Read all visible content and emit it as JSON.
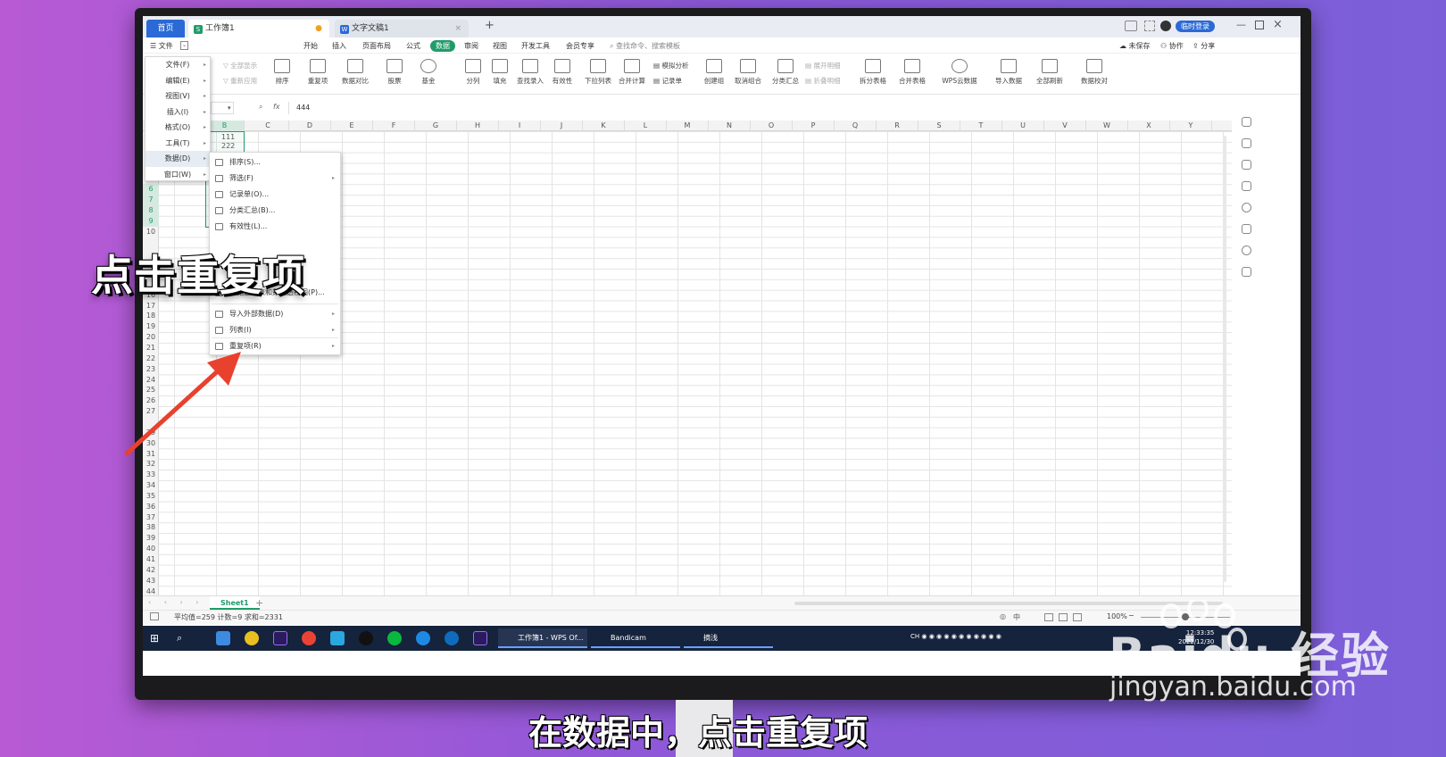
{
  "app": {
    "tab_home": "首页",
    "tab_workbook": "工作簿1",
    "tab_doc": "文字文稿1",
    "login_label": "临时登录"
  },
  "menubar": {
    "file": "文件",
    "tabs": [
      "开始",
      "插入",
      "页面布局",
      "公式",
      "数据",
      "审阅",
      "视图",
      "开发工具",
      "会员专享"
    ],
    "search_placeholder": "查找命令、搜索模板",
    "unsaved": "未保存",
    "collab": "协作",
    "share": "分享"
  },
  "ribbon": {
    "show_all": "全部显示",
    "reapply": "重新应用",
    "buttons": [
      "排序",
      "重复项",
      "数据对比",
      "股票",
      "基金",
      "分列",
      "填充",
      "查找录入",
      "有效性",
      "下拉列表",
      "合并计算",
      "创建组",
      "取消组合",
      "分类汇总",
      "拆分表格",
      "合并表格",
      "WPS云数据",
      "导入数据",
      "全部刷新",
      "数据校对"
    ],
    "simulate": "模拟分析",
    "record": "记录单",
    "expand": "展开明细",
    "collapse": "折叠明细"
  },
  "formula_bar": {
    "fx": "fx",
    "value": "444"
  },
  "columns": [
    "B",
    "C",
    "D",
    "E",
    "F",
    "G",
    "H",
    "I",
    "J",
    "K",
    "L",
    "M",
    "N",
    "O",
    "P",
    "Q",
    "R",
    "S",
    "T",
    "U",
    "V",
    "W",
    "X",
    "Y"
  ],
  "visible_rows": [
    "6",
    "7",
    "8",
    "9",
    "10",
    "16",
    "17",
    "18",
    "19",
    "20",
    "21",
    "22",
    "23",
    "24",
    "25",
    "26",
    "27",
    "29",
    "30",
    "31",
    "32",
    "33",
    "34",
    "35",
    "36",
    "37",
    "38",
    "39",
    "40",
    "41",
    "42",
    "43",
    "44"
  ],
  "cells": {
    "b1": "111",
    "b2": "222"
  },
  "left_menu": [
    {
      "label": "文件(F)"
    },
    {
      "label": "编辑(E)"
    },
    {
      "label": "视图(V)"
    },
    {
      "label": "插入(I)"
    },
    {
      "label": "格式(O)"
    },
    {
      "label": "工具(T)"
    },
    {
      "label": "数据(D)"
    },
    {
      "label": "窗口(W)"
    }
  ],
  "data_submenu": [
    {
      "label": "排序(S)..."
    },
    {
      "label": "筛选(F)"
    },
    {
      "label": "记录单(O)..."
    },
    {
      "label": "分类汇总(B)..."
    },
    {
      "label": "有效性(L)..."
    },
    {
      "label": "数据透视表和数据透视图(P)..."
    },
    {
      "label": "导入外部数据(D)"
    },
    {
      "label": "列表(I)"
    },
    {
      "label": "重复项(R)"
    }
  ],
  "sheet": {
    "tab": "Sheet1"
  },
  "status": {
    "summary": "平均值=259  计数=9  求和=2331",
    "zoom": "100%"
  },
  "taskbar": {
    "windows": [
      "工作簿1 - WPS Of...",
      "Bandicam",
      "摘浅"
    ],
    "time": "12:33:35",
    "date": "2022/12/30",
    "ime": "中"
  },
  "overlay": {
    "title": "点击重复项",
    "caption": "在数据中，点击重复项"
  },
  "watermark": {
    "brand": "Baidu 经验",
    "url": "jingyan.baidu.com"
  },
  "colors": {
    "accent": "#1f9c6a",
    "tab_blue": "#2b69d6",
    "arrow": "#e8412e",
    "taskbar": "#15233d"
  }
}
